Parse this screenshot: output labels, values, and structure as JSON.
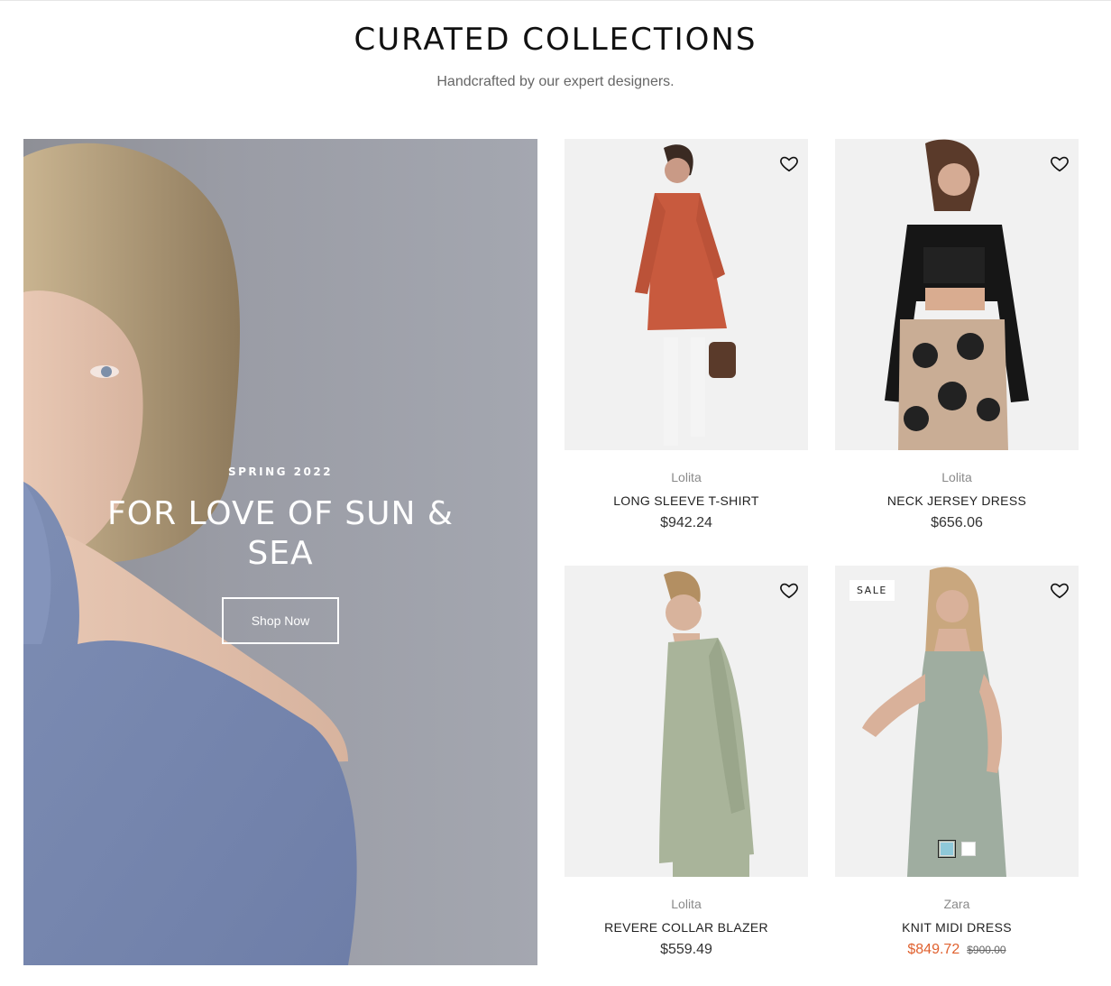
{
  "section": {
    "title": "CURATED COLLECTIONS",
    "subtitle": "Handcrafted by our expert designers."
  },
  "hero": {
    "eyebrow": "SPRING 2022",
    "title": "FOR LOVE OF SUN & SEA",
    "button_label": "Shop Now"
  },
  "products": [
    {
      "brand": "Lolita",
      "name": "LONG SLEEVE T-SHIRT",
      "price": "$942.24"
    },
    {
      "brand": "Lolita",
      "name": "NECK JERSEY DRESS",
      "price": "$656.06"
    },
    {
      "brand": "Lolita",
      "name": "REVERE COLLAR BLAZER",
      "price": "$559.49"
    },
    {
      "brand": "Zara",
      "name": "KNIT MIDI DRESS",
      "price": "$849.72",
      "compare_price": "$900.00",
      "badge": "SALE",
      "swatches": [
        "#8fc9d9",
        "#ffffff"
      ]
    }
  ],
  "colors": {
    "sale_price": "#e0612f",
    "badge_bg": "#ffffff"
  },
  "icons": {
    "wishlist": "heart-icon"
  }
}
